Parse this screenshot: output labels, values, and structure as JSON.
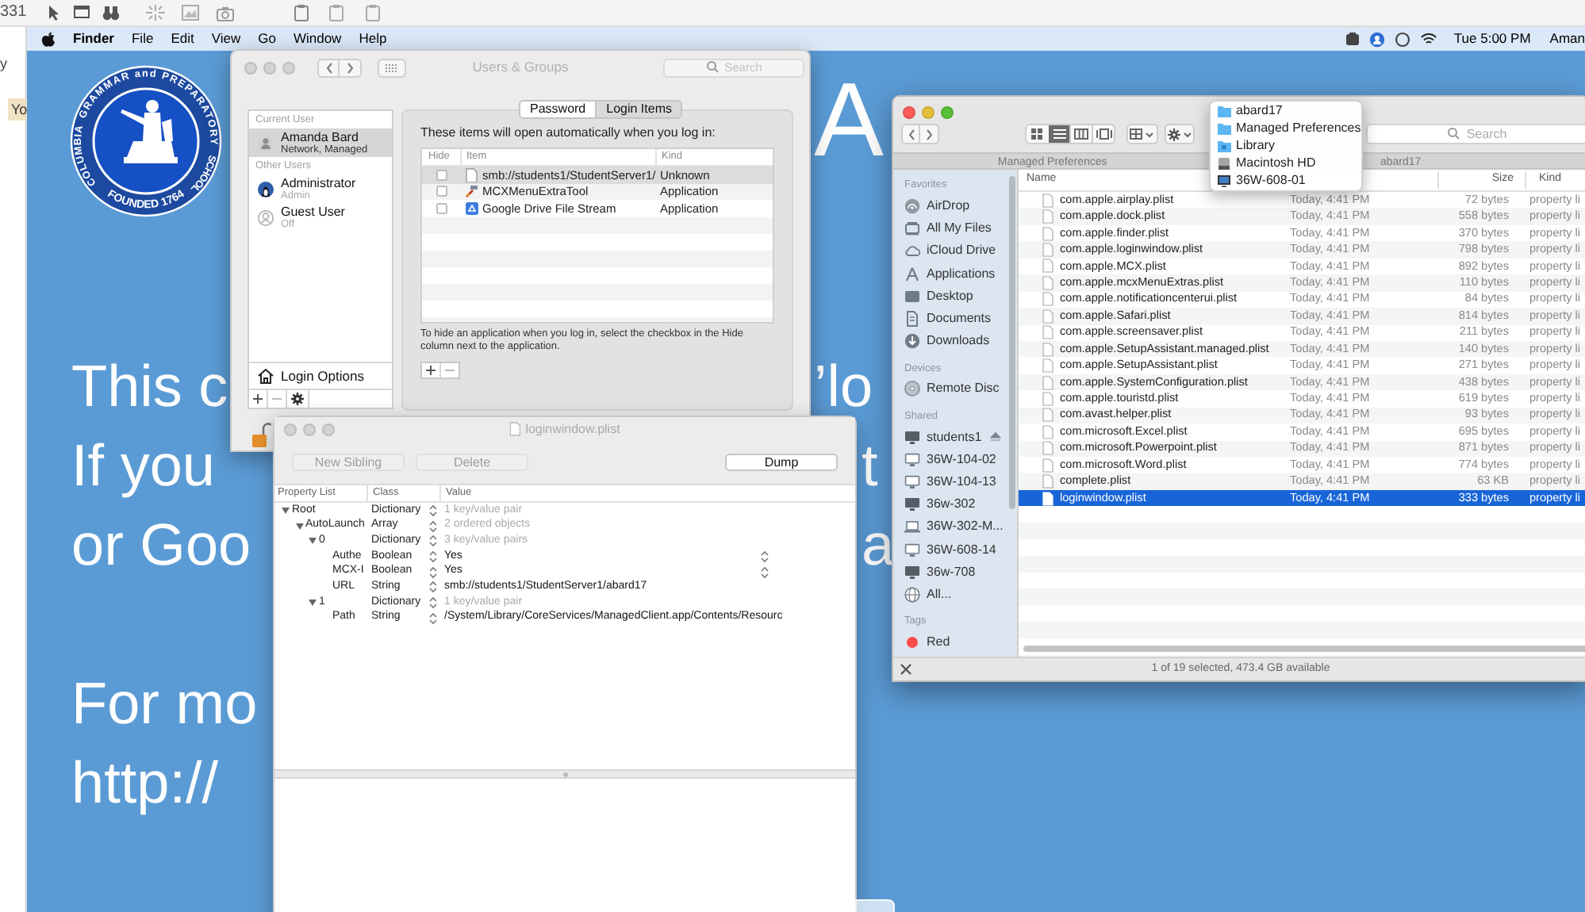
{
  "background_app": {
    "corner_text": "331",
    "side_text": "y",
    "tab_text": "Yo"
  },
  "menu_bar": {
    "app": "Finder",
    "items": [
      "File",
      "Edit",
      "View",
      "Go",
      "Window",
      "Help"
    ],
    "clock": "Tue 5:00 PM",
    "user": "Aman"
  },
  "slide": {
    "seal": {
      "ring_words": [
        "COLUMBIA",
        "GRAMMAR and PREPARATORY",
        "SCHOOL"
      ],
      "founded": "FOUNDED 1764"
    },
    "heading_fragment": "A",
    "lines": [
      {
        "left": "This c",
        "right": "’lo"
      },
      {
        "left": "If you",
        "right": "t"
      },
      {
        "left": "or Goo",
        "right": "a"
      },
      {
        "left": "For mo"
      },
      {
        "left": "http://"
      }
    ]
  },
  "users_groups": {
    "title": "Users & Groups",
    "search_placeholder": "Search",
    "sections": [
      {
        "header": "Current User",
        "users": [
          {
            "name": "Amanda Bard",
            "role": "Network, Managed",
            "selected": true
          }
        ]
      },
      {
        "header": "Other Users",
        "users": [
          {
            "name": "Administrator",
            "role": "Admin",
            "selected": false
          },
          {
            "name": "Guest User",
            "role": "Off",
            "selected": false
          }
        ]
      }
    ],
    "login_options": "Login Options",
    "tabs": [
      {
        "label": "Password",
        "selected": false
      },
      {
        "label": "Login Items",
        "selected": true
      }
    ],
    "intro": "These items will open automatically when you log in:",
    "columns": [
      "Hide",
      "Item",
      "Kind"
    ],
    "items": [
      {
        "hide": false,
        "name": "smb://students1/StudentServer1/",
        "kind": "Unknown",
        "selected": true
      },
      {
        "hide": false,
        "name": "MCXMenuExtraTool",
        "kind": "Application",
        "selected": false
      },
      {
        "hide": false,
        "name": "Google Drive File Stream",
        "kind": "Application",
        "selected": false
      }
    ],
    "hint": "To hide an application when you log in, select the checkbox in the Hide column next to the application."
  },
  "plist_editor": {
    "title": "loginwindow.plist",
    "buttons": [
      {
        "label": "New Sibling",
        "disabled": true
      },
      {
        "label": "Delete",
        "disabled": true
      },
      {
        "label": "Dump",
        "disabled": false
      }
    ],
    "columns": [
      "Property List",
      "Class",
      "Value"
    ],
    "rows": [
      {
        "key": "Root",
        "class": "Dictionary",
        "value": "1 key/value pair",
        "kind": "container",
        "expanded": true,
        "children": [
          {
            "key": "AutoLaunch",
            "class": "Array",
            "value": "2 ordered objects",
            "kind": "container",
            "expanded": true,
            "children": [
              {
                "key": "0",
                "class": "Dictionary",
                "value": "3 key/value pairs",
                "kind": "container",
                "expanded": true,
                "children": [
                  {
                    "key": "Authe",
                    "class": "Boolean",
                    "value": "Yes",
                    "kind": "choice"
                  },
                  {
                    "key": "MCX-I",
                    "class": "Boolean",
                    "value": "Yes",
                    "kind": "choice"
                  },
                  {
                    "key": "URL",
                    "class": "String",
                    "value": "smb://students1/StudentServer1/abard17",
                    "kind": "text"
                  }
                ]
              },
              {
                "key": "1",
                "class": "Dictionary",
                "value": "1 key/value pair",
                "kind": "container",
                "expanded": true,
                "children": [
                  {
                    "key": "Path",
                    "class": "String",
                    "value": "/System/Library/CoreServices/ManagedClient.app/Contents/Resourc",
                    "kind": "text"
                  }
                ]
              }
            ]
          }
        ]
      }
    ]
  },
  "finder": {
    "search_placeholder": "Search",
    "path_bar": [
      "Managed Preferences",
      "abard17"
    ],
    "path_menu": [
      {
        "label": "abard17"
      },
      {
        "label": "Managed Preferences"
      },
      {
        "label": "Library"
      },
      {
        "label": "Macintosh HD"
      },
      {
        "label": "36W-608-01"
      }
    ],
    "sidebar": [
      {
        "header": "Favorites",
        "items": [
          {
            "label": "AirDrop"
          },
          {
            "label": "All My Files"
          },
          {
            "label": "iCloud Drive"
          },
          {
            "label": "Applications"
          },
          {
            "label": "Desktop"
          },
          {
            "label": "Documents"
          },
          {
            "label": "Downloads"
          }
        ]
      },
      {
        "header": "Devices",
        "items": [
          {
            "label": "Remote Disc"
          }
        ]
      },
      {
        "header": "Shared",
        "items": [
          {
            "label": "students1",
            "eject": true
          },
          {
            "label": "36W-104-02",
            "eject": false
          },
          {
            "label": "36W-104-13",
            "eject": false
          },
          {
            "label": "36w-302",
            "eject": false
          },
          {
            "label": "36W-302-M...",
            "eject": false
          },
          {
            "label": "36W-608-14",
            "eject": false
          },
          {
            "label": "36w-708",
            "eject": false
          },
          {
            "label": "All...",
            "eject": false
          }
        ]
      },
      {
        "header": "Tags",
        "items": [
          {
            "label": "Red",
            "color": "#fc4d4d"
          }
        ]
      }
    ],
    "columns": [
      "Name",
      "Size",
      "Kind"
    ],
    "files": [
      {
        "name": "com.apple.airplay.plist",
        "date": "Today, 4:41 PM",
        "size": "72 bytes",
        "kind": "property li",
        "selected": false
      },
      {
        "name": "com.apple.dock.plist",
        "date": "Today, 4:41 PM",
        "size": "558 bytes",
        "kind": "property li",
        "selected": false
      },
      {
        "name": "com.apple.finder.plist",
        "date": "Today, 4:41 PM",
        "size": "370 bytes",
        "kind": "property li",
        "selected": false
      },
      {
        "name": "com.apple.loginwindow.plist",
        "date": "Today, 4:41 PM",
        "size": "798 bytes",
        "kind": "property li",
        "selected": false
      },
      {
        "name": "com.apple.MCX.plist",
        "date": "Today, 4:41 PM",
        "size": "892 bytes",
        "kind": "property li",
        "selected": false
      },
      {
        "name": "com.apple.mcxMenuExtras.plist",
        "date": "Today, 4:41 PM",
        "size": "110 bytes",
        "kind": "property li",
        "selected": false
      },
      {
        "name": "com.apple.notificationcenterui.plist",
        "date": "Today, 4:41 PM",
        "size": "84 bytes",
        "kind": "property li",
        "selected": false
      },
      {
        "name": "com.apple.Safari.plist",
        "date": "Today, 4:41 PM",
        "size": "814 bytes",
        "kind": "property li",
        "selected": false
      },
      {
        "name": "com.apple.screensaver.plist",
        "date": "Today, 4:41 PM",
        "size": "211 bytes",
        "kind": "property li",
        "selected": false
      },
      {
        "name": "com.apple.SetupAssistant.managed.plist",
        "date": "Today, 4:41 PM",
        "size": "140 bytes",
        "kind": "property li",
        "selected": false
      },
      {
        "name": "com.apple.SetupAssistant.plist",
        "date": "Today, 4:41 PM",
        "size": "271 bytes",
        "kind": "property li",
        "selected": false
      },
      {
        "name": "com.apple.SystemConfiguration.plist",
        "date": "Today, 4:41 PM",
        "size": "438 bytes",
        "kind": "property li",
        "selected": false
      },
      {
        "name": "com.apple.touristd.plist",
        "date": "Today, 4:41 PM",
        "size": "619 bytes",
        "kind": "property li",
        "selected": false
      },
      {
        "name": "com.avast.helper.plist",
        "date": "Today, 4:41 PM",
        "size": "93 bytes",
        "kind": "property li",
        "selected": false
      },
      {
        "name": "com.microsoft.Excel.plist",
        "date": "Today, 4:41 PM",
        "size": "695 bytes",
        "kind": "property li",
        "selected": false
      },
      {
        "name": "com.microsoft.Powerpoint.plist",
        "date": "Today, 4:41 PM",
        "size": "871 bytes",
        "kind": "property li",
        "selected": false
      },
      {
        "name": "com.microsoft.Word.plist",
        "date": "Today, 4:41 PM",
        "size": "774 bytes",
        "kind": "property li",
        "selected": false
      },
      {
        "name": "complete.plist",
        "date": "Today, 4:41 PM",
        "size": "63 KB",
        "kind": "property li",
        "selected": false
      },
      {
        "name": "loginwindow.plist",
        "date": "Today, 4:41 PM",
        "size": "333 bytes",
        "kind": "property li",
        "selected": true
      }
    ],
    "status": "1 of 19 selected, 473.4 GB available"
  }
}
